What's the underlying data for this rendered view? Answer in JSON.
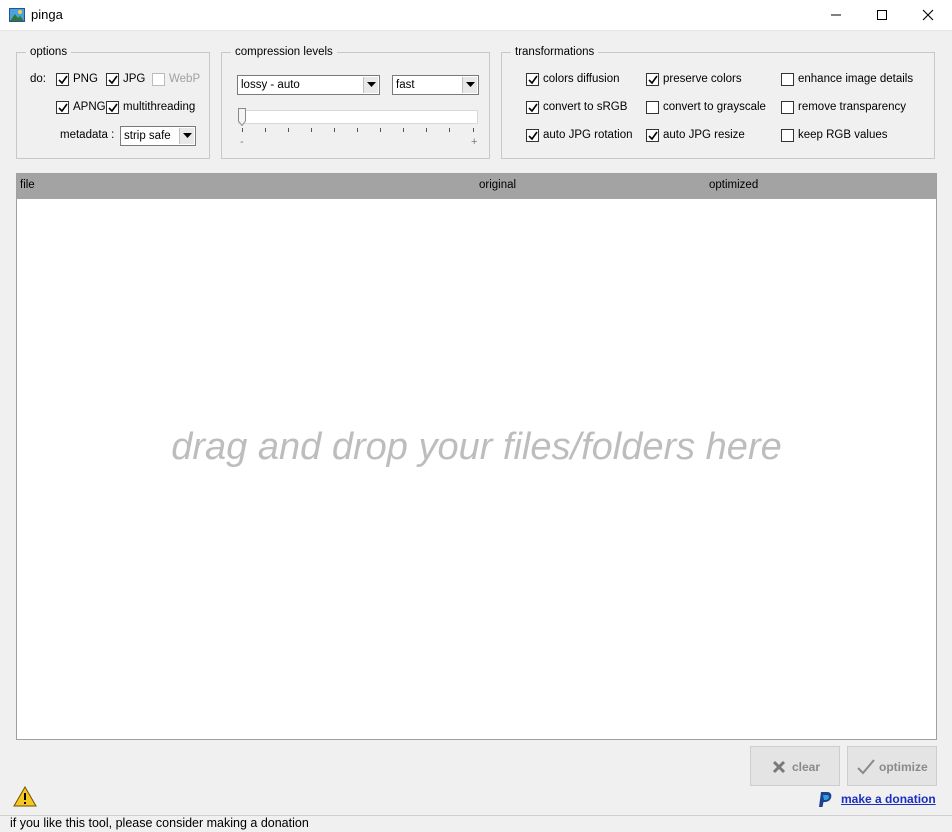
{
  "window": {
    "title": "pinga"
  },
  "options": {
    "legend": "options",
    "do_label": "do:",
    "png": {
      "label": "PNG",
      "checked": true
    },
    "jpg": {
      "label": "JPG",
      "checked": true
    },
    "webp": {
      "label": "WebP",
      "checked": false,
      "disabled": true
    },
    "apng": {
      "label": "APNG",
      "checked": true
    },
    "multithreading": {
      "label": "multithreading",
      "checked": true
    },
    "metadata_label": "metadata :",
    "metadata_value": "strip safe"
  },
  "compression": {
    "legend": "compression levels",
    "mode_value": "lossy - auto",
    "speed_value": "fast",
    "slider_min_label": "-",
    "slider_max_label": "+",
    "slider_level": 0
  },
  "transformations": {
    "legend": "transformations",
    "items": [
      {
        "label": "colors diffusion",
        "checked": true
      },
      {
        "label": "preserve colors",
        "checked": true
      },
      {
        "label": "enhance image details",
        "checked": false
      },
      {
        "label": "convert to sRGB",
        "checked": true
      },
      {
        "label": "convert to grayscale",
        "checked": false
      },
      {
        "label": "remove transparency",
        "checked": false
      },
      {
        "label": "auto JPG rotation",
        "checked": true
      },
      {
        "label": "auto JPG resize",
        "checked": true
      },
      {
        "label": "keep RGB values",
        "checked": false
      }
    ]
  },
  "filelist": {
    "columns": [
      "file",
      "original",
      "optimized"
    ],
    "drop_hint": "drag and drop your files/folders here"
  },
  "actions": {
    "clear_label": "clear",
    "optimize_label": "optimize"
  },
  "footer": {
    "donation_link": "make a donation",
    "status_text": "if you like this tool, please consider making a donation"
  },
  "colors": {
    "header_bg": "#a3a3a3",
    "link": "#1a2fbf",
    "hint_text": "#bdbdbd"
  }
}
